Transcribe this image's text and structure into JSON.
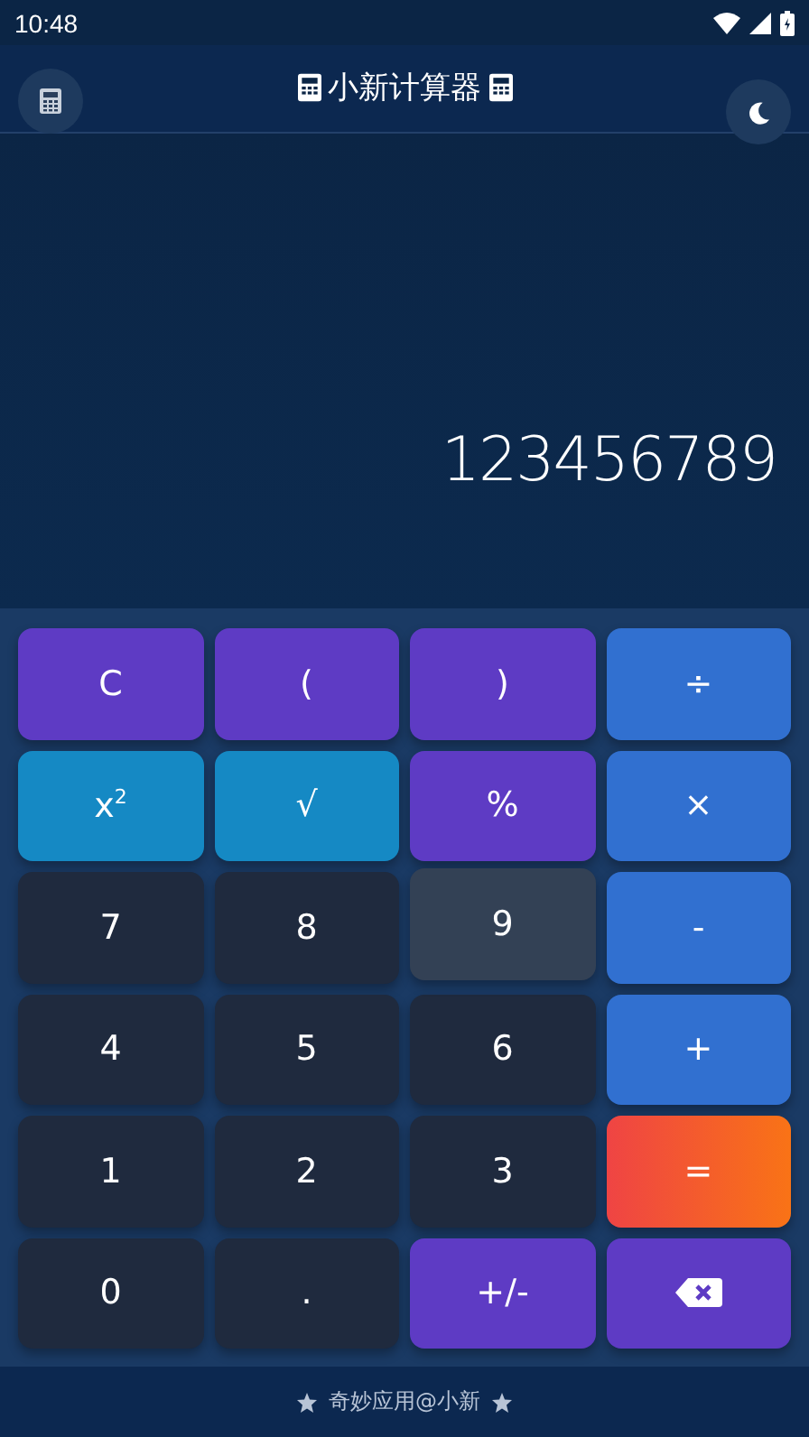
{
  "status_bar": {
    "time": "10:48"
  },
  "header": {
    "title": "小新计算器"
  },
  "display": {
    "value": "123456789"
  },
  "keys": [
    {
      "label": "C",
      "kind": "purple",
      "pressed": false
    },
    {
      "label": "(",
      "kind": "purple",
      "pressed": false
    },
    {
      "label": ")",
      "kind": "purple",
      "pressed": false
    },
    {
      "label": "÷",
      "kind": "blue",
      "pressed": false
    },
    {
      "label": "x$^{2}$",
      "kind": "cyan",
      "pressed": false
    },
    {
      "label": "√",
      "kind": "cyan",
      "pressed": false
    },
    {
      "label": "%",
      "kind": "purple",
      "pressed": false
    },
    {
      "label": "×",
      "kind": "blue",
      "pressed": false
    },
    {
      "label": "7",
      "kind": "number",
      "pressed": false
    },
    {
      "label": "8",
      "kind": "number",
      "pressed": false
    },
    {
      "label": "9",
      "kind": "number",
      "pressed": true
    },
    {
      "label": "-",
      "kind": "blue",
      "pressed": false
    },
    {
      "label": "4",
      "kind": "number",
      "pressed": false
    },
    {
      "label": "5",
      "kind": "number",
      "pressed": false
    },
    {
      "label": "6",
      "kind": "number",
      "pressed": false
    },
    {
      "label": "+",
      "kind": "blue",
      "pressed": false
    },
    {
      "label": "1",
      "kind": "number",
      "pressed": false
    },
    {
      "label": "2",
      "kind": "number",
      "pressed": false
    },
    {
      "label": "3",
      "kind": "number",
      "pressed": false
    },
    {
      "label": "=",
      "kind": "equals",
      "pressed": false
    },
    {
      "label": "0",
      "kind": "number",
      "pressed": false
    },
    {
      "label": ".",
      "kind": "number",
      "pressed": false
    },
    {
      "label": "+/-",
      "kind": "purple",
      "pressed": false
    },
    {
      "kind": "backspace",
      "pressed": false
    }
  ],
  "footer": {
    "text": "奇妙应用@小新"
  }
}
